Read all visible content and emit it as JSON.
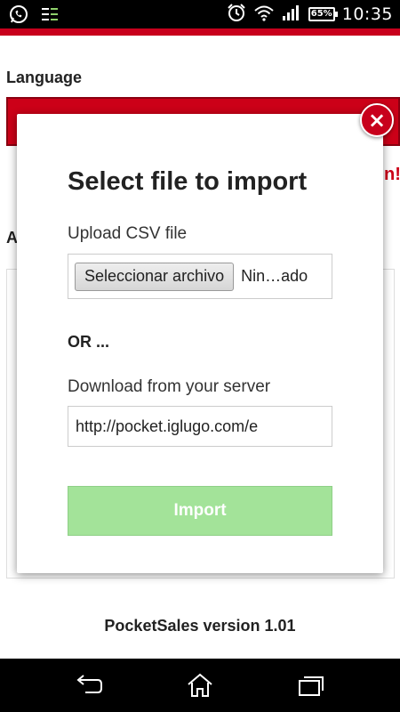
{
  "status_bar": {
    "time": "10:35",
    "battery": "65%",
    "icons": [
      "whatsapp-icon",
      "notification-icon",
      "alarm-icon",
      "wifi-icon",
      "signal-icon",
      "battery-icon"
    ]
  },
  "page": {
    "language_label": "Language",
    "a_label": "A",
    "red_partial_text": "n!",
    "version": "PocketSales version 1.01"
  },
  "modal": {
    "title": "Select file to import",
    "upload_label": "Upload CSV file",
    "file_button_label": "Seleccionar archivo",
    "file_status": "Nin…ado",
    "or_label": "OR ...",
    "download_label": "Download from your server",
    "url_value": "http://pocket.iglugo.com/e",
    "import_label": "Import",
    "close_icon": "×"
  },
  "nav_bar": {
    "icons": [
      "back-icon",
      "home-icon",
      "recent-apps-icon"
    ]
  },
  "colors": {
    "accent_red": "#c8001c",
    "import_green": "#a3e399"
  }
}
